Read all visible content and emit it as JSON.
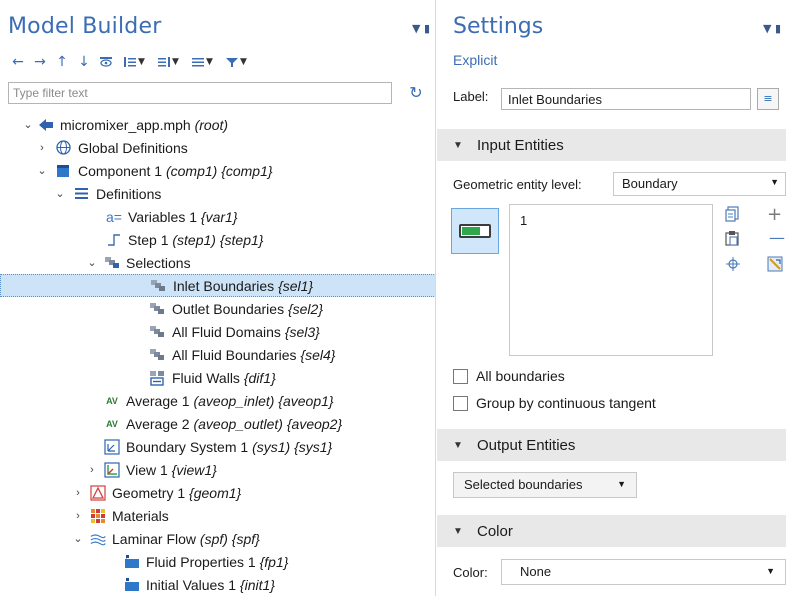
{
  "model_builder": {
    "title": "Model Builder",
    "filter_placeholder": "Type filter text",
    "tree": [
      {
        "label": "micromixer_app.mph",
        "tag": "(root)",
        "icon": "model-icon",
        "expanded": true
      },
      {
        "label": "Global Definitions",
        "tag": "",
        "icon": "globe-icon",
        "expanded": false
      },
      {
        "label": "Component 1",
        "tag": "(comp1) {comp1}",
        "icon": "component-icon",
        "expanded": true
      },
      {
        "label": "Definitions",
        "tag": "",
        "icon": "definitions-icon",
        "expanded": true
      },
      {
        "label": "Variables 1",
        "tag": "{var1}",
        "icon": "variables-icon"
      },
      {
        "label": "Step 1",
        "tag": "(step1) {step1}",
        "icon": "step-function-icon"
      },
      {
        "label": "Selections",
        "tag": "",
        "icon": "selections-icon",
        "expanded": true
      },
      {
        "label": "Inlet Boundaries",
        "tag": "{sel1}",
        "icon": "selection-icon",
        "selected": true
      },
      {
        "label": "Outlet Boundaries",
        "tag": "{sel2}",
        "icon": "selection-icon"
      },
      {
        "label": "All Fluid Domains",
        "tag": "{sel3}",
        "icon": "selection-icon"
      },
      {
        "label": "All Fluid Boundaries",
        "tag": "{sel4}",
        "icon": "selection-icon"
      },
      {
        "label": "Fluid Walls",
        "tag": "{dif1}",
        "icon": "difference-icon"
      },
      {
        "label": "Average 1",
        "tag": "(aveop_inlet) {aveop1}",
        "icon": "average-icon"
      },
      {
        "label": "Average 2",
        "tag": "(aveop_outlet) {aveop2}",
        "icon": "average-icon"
      },
      {
        "label": "Boundary System 1",
        "tag": "(sys1) {sys1}",
        "icon": "coordinate-system-icon"
      },
      {
        "label": "View 1",
        "tag": "{view1}",
        "icon": "view-icon",
        "expanded": false
      },
      {
        "label": "Geometry 1",
        "tag": "{geom1}",
        "icon": "geometry-icon",
        "expanded": false
      },
      {
        "label": "Materials",
        "tag": "",
        "icon": "materials-icon",
        "expanded": false
      },
      {
        "label": "Laminar Flow",
        "tag": "(spf) {spf}",
        "icon": "laminar-flow-icon",
        "expanded": true
      },
      {
        "label": "Fluid Properties 1",
        "tag": "{fp1}",
        "icon": "fluid-properties-icon"
      },
      {
        "label": "Initial Values 1",
        "tag": "{init1}",
        "icon": "initial-values-icon"
      }
    ]
  },
  "settings": {
    "title": "Settings",
    "subtitle": "Explicit",
    "label_caption": "Label:",
    "label_value": "Inlet Boundaries",
    "sections": {
      "input": "Input Entities",
      "output": "Output Entities",
      "color": "Color"
    },
    "geo_level_caption": "Geometric entity level:",
    "geo_level_value": "Boundary",
    "selection_list": [
      "1"
    ],
    "checkbox_all": "All boundaries",
    "checkbox_tangent": "Group by continuous tangent",
    "output_value": "Selected boundaries",
    "color_caption": "Color:",
    "color_value": "None"
  },
  "colors": {
    "accent": "#3b6cb4",
    "selection": "#cce3f8",
    "section_bg": "#e8e8e8"
  }
}
